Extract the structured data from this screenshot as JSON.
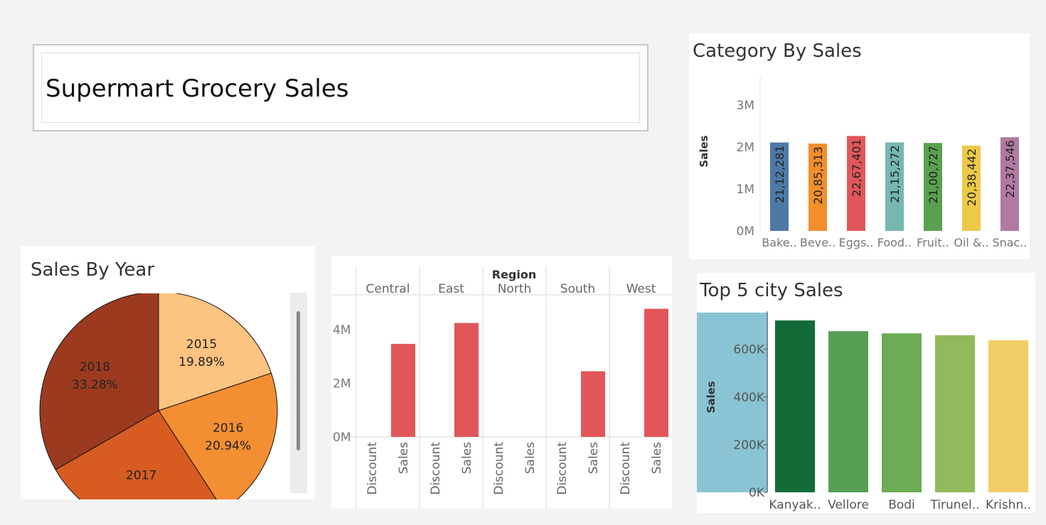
{
  "dashboard": {
    "title": "Supermart Grocery Sales"
  },
  "panels": {
    "category": "Category By Sales",
    "year": "Sales By Year",
    "city": "Top 5 city Sales"
  },
  "chart_data": [
    {
      "type": "bar",
      "title": "Category By Sales",
      "ylabel": "Sales",
      "categories": [
        "Bake..",
        "Beve..",
        "Eggs..",
        "Food..",
        "Fruit..",
        "Oil &..",
        "Snac.."
      ],
      "values": [
        2112281,
        2085313,
        2267401,
        2115272,
        2100727,
        2038442,
        2237546
      ],
      "labels": [
        "21,12,281",
        "20,85,313",
        "22,67,401",
        "21,15,272",
        "21,00,727",
        "20,38,442",
        "22,37,546"
      ],
      "colors": [
        "#4e79a7",
        "#f28e2b",
        "#e15759",
        "#76b7b2",
        "#59a14f",
        "#edc948",
        "#b07aa1"
      ],
      "ylim": [
        0,
        3700000
      ],
      "yticks": [
        0,
        1000000,
        2000000,
        3000000
      ],
      "ytick_labels": [
        "0M",
        "1M",
        "2M",
        "3M"
      ]
    },
    {
      "type": "pie",
      "title": "Sales By Year",
      "categories": [
        "2015",
        "2016",
        "2017",
        "2018"
      ],
      "values": [
        19.89,
        20.94,
        25.89,
        33.28
      ],
      "labels": [
        "19.89%",
        "20.94%",
        "",
        "33.28%"
      ],
      "colors": [
        "#fdc381",
        "#f38e33",
        "#d75c22",
        "#9c3a20"
      ]
    },
    {
      "type": "bar",
      "column_header": "Region",
      "facets": [
        "Central",
        "East",
        "North",
        "South",
        "West"
      ],
      "categories": [
        "Discount",
        "Sales"
      ],
      "series": [
        {
          "name": "Discount",
          "values": [
            0,
            0,
            0,
            0,
            0
          ]
        },
        {
          "name": "Sales",
          "values": [
            3470000,
            4250000,
            0,
            2450000,
            4780000
          ]
        }
      ],
      "bar_color": "#e15759",
      "ylim": [
        -300000,
        5000000
      ],
      "yticks": [
        0,
        2000000,
        4000000
      ],
      "ytick_labels": [
        "0M",
        "2M",
        "4M"
      ]
    },
    {
      "type": "bar",
      "title": "Top 5 city Sales",
      "ylabel": "Sales",
      "categories": [
        "Kanyak..",
        "Vellore",
        "Bodi",
        "Tirunel..",
        "Krishn.."
      ],
      "values": [
        721000,
        676000,
        667000,
        659000,
        638000
      ],
      "colors": [
        "#136c38",
        "#55a054",
        "#6bac55",
        "#92b95b",
        "#f1ce65"
      ],
      "highlight_color": "#8ac4d4",
      "ylim": [
        0,
        760000
      ],
      "yticks": [
        0,
        200000,
        400000,
        600000
      ],
      "ytick_labels": [
        "0K",
        "200K",
        "400K",
        "600K"
      ]
    }
  ]
}
